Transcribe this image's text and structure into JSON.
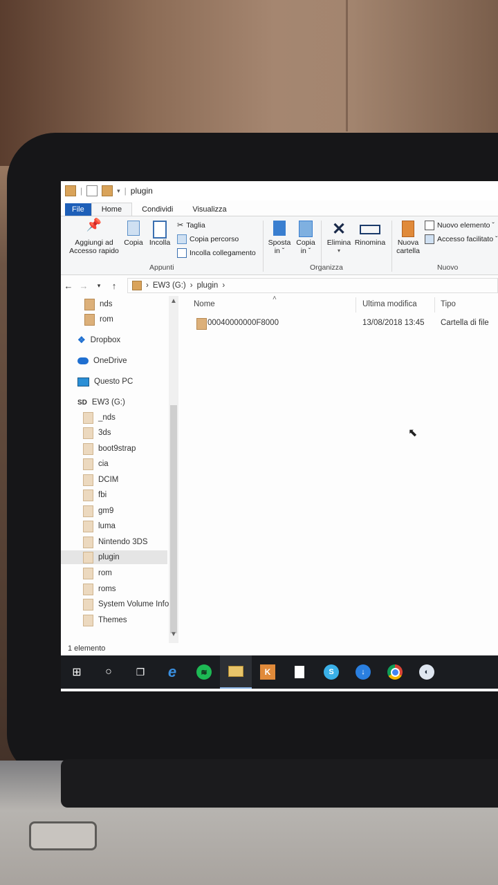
{
  "window": {
    "title": "plugin"
  },
  "ribbon": {
    "tabs": [
      "File",
      "Home",
      "Condividi",
      "Visualizza"
    ],
    "pin": "Aggiungi ad\nAccesso rapido",
    "copy": "Copia",
    "paste": "Incolla",
    "cut": "Taglia",
    "copy_path": "Copia percorso",
    "paste_link": "Incolla collegamento",
    "group_clipboard": "Appunti",
    "move_to": "Sposta\nin ˇ",
    "copy_to": "Copia\nin ˇ",
    "delete": "Elimina",
    "rename": "Rinomina",
    "group_organize": "Organizza",
    "new_folder": "Nuova\ncartella",
    "new_item": "Nuovo elemento ˇ",
    "easy_access": "Accesso facilitato ˇ",
    "group_new": "Nuovo"
  },
  "address": {
    "drive": "EW3 (G:)",
    "folder": "plugin"
  },
  "nav_pane": {
    "items": [
      "nds",
      "rom",
      "Dropbox",
      "OneDrive",
      "Questo PC",
      "EW3 (G:)",
      "_nds",
      "3ds",
      "boot9strap",
      "cia",
      "DCIM",
      "fbi",
      "gm9",
      "luma",
      "Nintendo 3DS",
      "plugin",
      "rom",
      "roms",
      "System Volume Inforr",
      "Themes"
    ]
  },
  "file_list": {
    "columns": [
      "Nome",
      "Ultima modifica",
      "Tipo"
    ],
    "rows": [
      {
        "name": "00040000000F8000",
        "modified": "13/08/2018 13:45",
        "type": "Cartella di file"
      }
    ]
  },
  "status": {
    "count": "1 elemento"
  },
  "taskbar": {
    "items": [
      "windows-start",
      "cortana",
      "task-view",
      "edge",
      "spotify",
      "file-explorer",
      "app-k",
      "notepad",
      "skype",
      "downloader",
      "chrome",
      "steam"
    ]
  },
  "colors": {
    "file_tab": "#1e5fb8",
    "folder": "#dcb07a",
    "taskbar": "#1a1c20"
  }
}
